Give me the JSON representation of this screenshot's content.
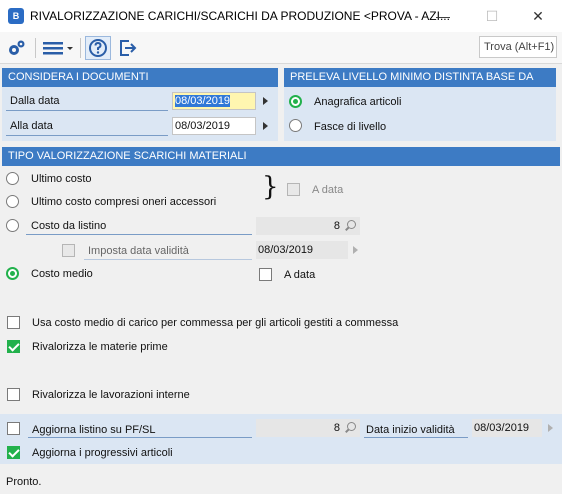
{
  "window": {
    "title": "RIVALORIZZAZIONE CARICHI/SCARICHI DA PRODUZIONE <PROVA - AZI...",
    "app_icon_text": "B",
    "minimize": "—",
    "maximize": "☐",
    "close": "✕"
  },
  "toolbar": {
    "search_placeholder": "Trova (Alt+F1)"
  },
  "documents": {
    "header": "CONSIDERA I DOCUMENTI",
    "from_label": "Dalla data",
    "from_value": "08/03/2019",
    "to_label": "Alla data",
    "to_value": "08/03/2019"
  },
  "min_level": {
    "header": "PRELEVA LIVELLO MINIMO DISTINTA BASE DA",
    "option1": "Anagrafica articoli",
    "option2": "Fasce di livello",
    "selected": "option1"
  },
  "valuation": {
    "header": "TIPO VALORIZZAZIONE SCARICHI MATERIALI",
    "ultimo_costo": "Ultimo costo",
    "ultimo_costo_oneri": "Ultimo costo compresi oneri accessori",
    "brace": "}",
    "a_data_1": "A data",
    "costo_listino": "Costo da listino",
    "listino_value": "8",
    "imposta_data": "Imposta data validità",
    "imposta_data_value": "08/03/2019",
    "costo_medio": "Costo medio",
    "a_data_2": "A data",
    "selected": "costo_medio"
  },
  "options": {
    "costo_medio_commessa": "Usa costo medio di carico per commessa per gli articoli gestiti a commessa",
    "costo_medio_commessa_checked": false,
    "materie_prime": "Rivalorizza le materie prime",
    "materie_prime_checked": true,
    "lavorazioni": "Rivalorizza le lavorazioni interne",
    "lavorazioni_checked": false
  },
  "update": {
    "listino_label": "Aggiorna listino su PF/SL",
    "listino_checked": false,
    "listino_value": "8",
    "data_inizio_label": "Data inizio validità",
    "data_inizio_value": "08/03/2019",
    "progressivi_label": "Aggiorna i progressivi articoli",
    "progressivi_checked": true
  },
  "status": {
    "text": "Pronto."
  },
  "colors": {
    "header_blue": "#3d7bc4",
    "panel_blue": "#dbe6f3",
    "check_green": "#22b14c",
    "active_field": "#fff6b0"
  }
}
